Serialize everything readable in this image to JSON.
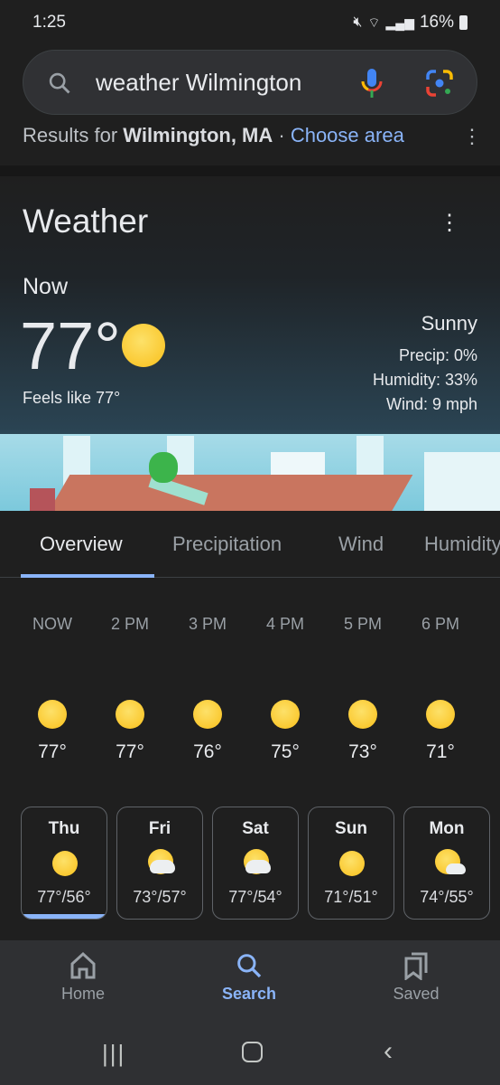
{
  "status": {
    "time": "1:25",
    "battery": "16%"
  },
  "search": {
    "query": "weather Wilmington"
  },
  "results": {
    "prefix": "Results for ",
    "location": "Wilmington, MA",
    "sep": " · ",
    "choose": "Choose area"
  },
  "weather": {
    "title": "Weather",
    "now": "Now",
    "temp": "77°",
    "feels": "Feels like 77°",
    "condition": "Sunny",
    "precip": "Precip: 0%",
    "humidity": "Humidity: 33%",
    "wind": "Wind: 9 mph"
  },
  "tabs": [
    {
      "label": "Overview",
      "active": true
    },
    {
      "label": "Precipitation"
    },
    {
      "label": "Wind"
    },
    {
      "label": "Humidity"
    }
  ],
  "hourly": [
    {
      "time": "NOW",
      "temp": "77°"
    },
    {
      "time": "2 PM",
      "temp": "77°"
    },
    {
      "time": "3 PM",
      "temp": "76°"
    },
    {
      "time": "4 PM",
      "temp": "75°"
    },
    {
      "time": "5 PM",
      "temp": "73°"
    },
    {
      "time": "6 PM",
      "temp": "71°"
    }
  ],
  "daily": [
    {
      "day": "Thu",
      "temps": "77°/56°",
      "icon": "sunny",
      "selected": true
    },
    {
      "day": "Fri",
      "temps": "73°/57°",
      "icon": "partly-cloudy"
    },
    {
      "day": "Sat",
      "temps": "77°/54°",
      "icon": "partly-cloudy"
    },
    {
      "day": "Sun",
      "temps": "71°/51°",
      "icon": "sunny"
    },
    {
      "day": "Mon",
      "temps": "74°/55°",
      "icon": "mostly-sunny"
    }
  ],
  "bottom_nav": [
    {
      "label": "Home"
    },
    {
      "label": "Search",
      "active": true
    },
    {
      "label": "Saved"
    }
  ],
  "colors": {
    "accent": "#8ab4f8",
    "sun": "#fbc02d"
  }
}
